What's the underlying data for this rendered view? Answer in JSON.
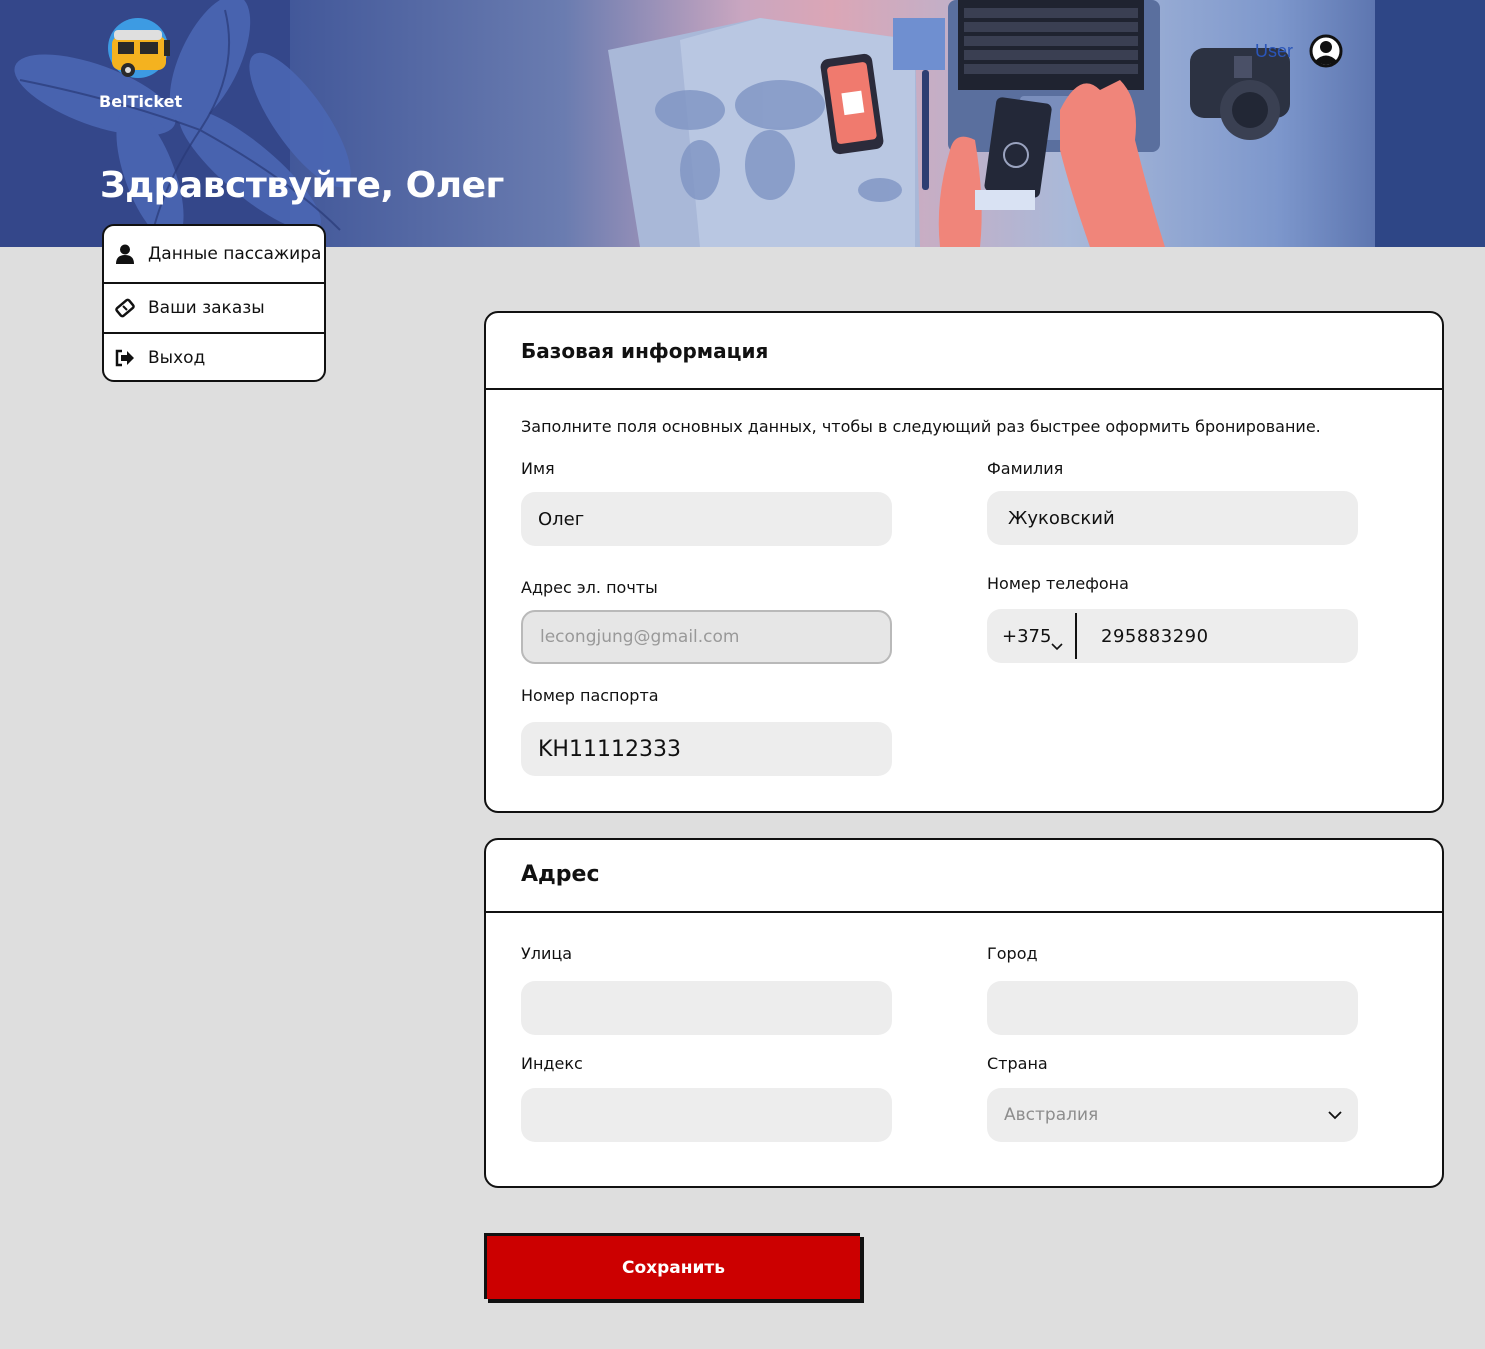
{
  "brand": {
    "name": "BelTicket"
  },
  "header": {
    "greeting": "Здравствуйте, Олег",
    "user_link": "User"
  },
  "sidebar": {
    "items": [
      {
        "label": "Данные пассажира",
        "icon": "user-icon"
      },
      {
        "label": "Ваши заказы",
        "icon": "ticket-icon"
      },
      {
        "label": "Выход",
        "icon": "logout-icon"
      }
    ]
  },
  "basic_info": {
    "title": "Базовая информация",
    "description": "Заполните поля основных данных, чтобы в следующий раз быстрее оформить бронирование.",
    "first_name": {
      "label": "Имя",
      "value": "Олег"
    },
    "last_name": {
      "label": "Фамилия",
      "value": "Жуковский"
    },
    "email": {
      "label": "Адрес эл. почты",
      "value": "lecongjung@gmail.com"
    },
    "phone": {
      "label": "Номер телефона",
      "code": "+375",
      "number": "295883290"
    },
    "passport": {
      "label": "Номер паспорта",
      "value": "KH11112333"
    }
  },
  "address": {
    "title": "Адрес",
    "street": {
      "label": "Улица",
      "value": ""
    },
    "city": {
      "label": "Город",
      "value": ""
    },
    "zip": {
      "label": "Индекс",
      "value": ""
    },
    "country": {
      "label": "Страна",
      "value": "Австралия"
    }
  },
  "actions": {
    "save_label": "Сохранить"
  },
  "colors": {
    "accent": "#cc0000",
    "link": "#2a55b8",
    "field_bg": "#ededed",
    "page_bg": "#dedede"
  }
}
